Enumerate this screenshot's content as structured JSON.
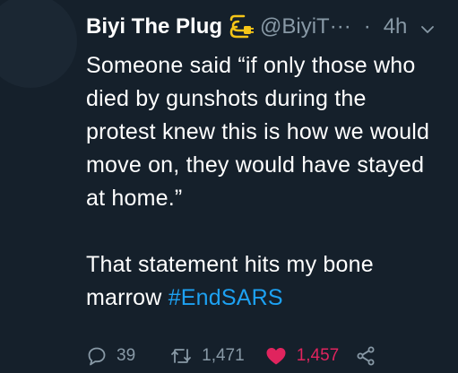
{
  "tweet": {
    "author_name": "Biyi The Plug",
    "handle": "@BiyiT···",
    "separator": "·",
    "time": "4h",
    "body_lines": [
      "Someone said   “if only those who",
      "died by gunshots during the",
      "protest knew this is how we would",
      "move on, they would have stayed",
      "at home.”"
    ],
    "body_line_6_text": "That statement hits my bone",
    "body_line_7_text": "marrow ",
    "hashtag": "#EndSARS",
    "replies": "39",
    "retweets": "1,471",
    "likes": "1,457"
  },
  "icons": {
    "name_badge": "plug-icon",
    "menu": "chevron-down-icon",
    "reply": "speech-bubble-icon",
    "retweet": "retweet-icon",
    "like": "heart-icon",
    "share": "share-icon"
  },
  "colors": {
    "background": "#15202b",
    "secondary_text": "#8899a6",
    "link": "#1da1f2",
    "like": "#e0245e",
    "plug_badge": "#f5c518"
  }
}
